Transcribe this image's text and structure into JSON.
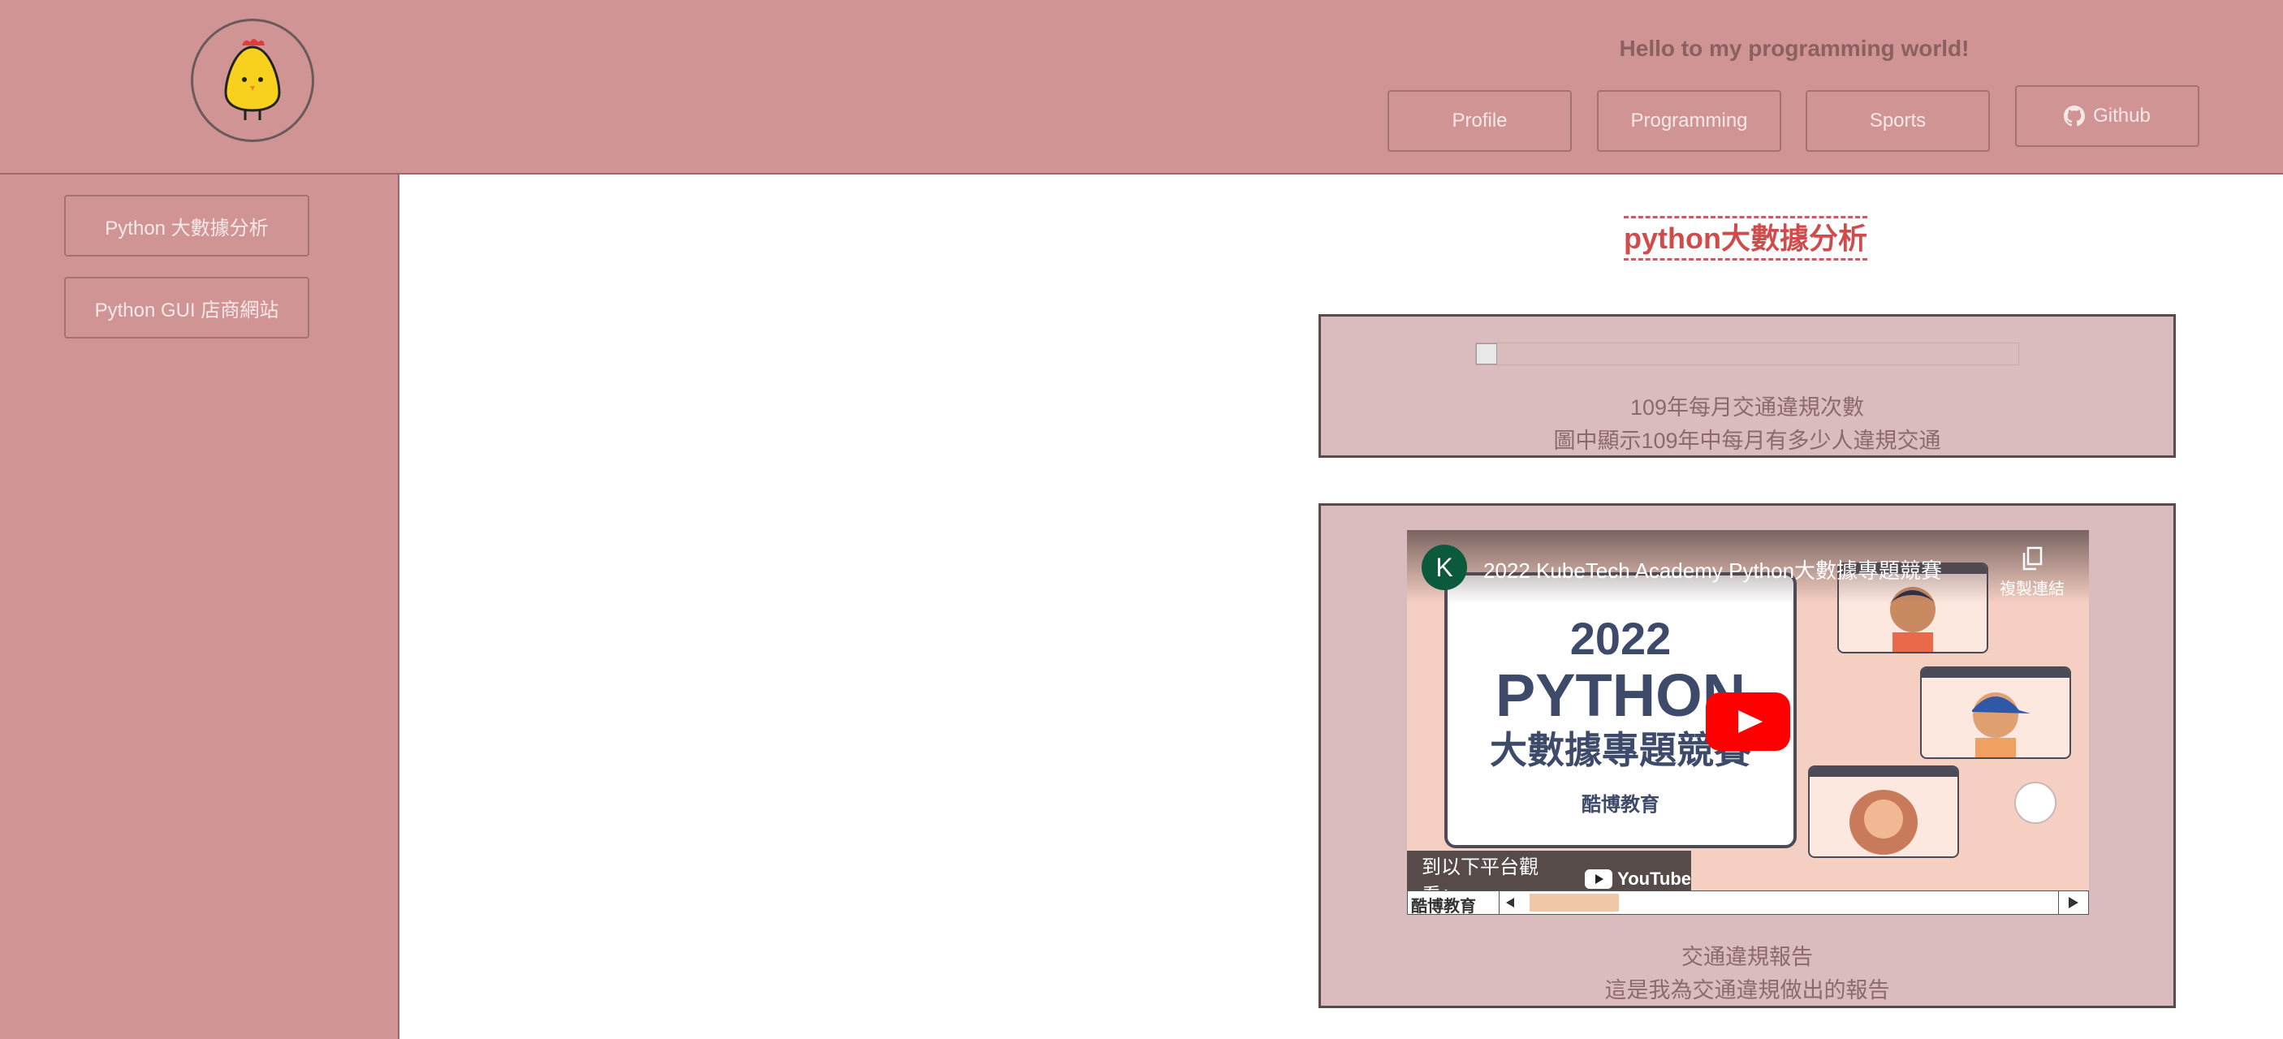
{
  "header": {
    "tagline": "Hello to my programming world!",
    "nav": [
      {
        "label": "Profile"
      },
      {
        "label": "Programming"
      },
      {
        "label": "Sports"
      },
      {
        "label": "Github",
        "icon": "github-icon"
      }
    ],
    "logo_icon": "chick-icon"
  },
  "sidebar": {
    "items": [
      {
        "label": "Python 大數據分析"
      },
      {
        "label": "Python GUI 店商網站"
      }
    ]
  },
  "main": {
    "title": "python大數據分析",
    "image_card": {
      "caption_title": "109年每月交通違規次數",
      "caption_desc": "圖中顯示109年中每月有多少人違規交通"
    },
    "video_card": {
      "video": {
        "channel_initial": "K",
        "title": "2022 KubeTech Academy Python大數據專題競賽",
        "copy_link": "複製連結",
        "slide_year": "2022",
        "slide_python": "PYTHON",
        "slide_subtitle": "大數據專題競賽",
        "slide_org": "酷博教育",
        "watch_on": "到以下平台觀看：",
        "youtube": "YouTube",
        "scroll_label": "酷博教育"
      },
      "caption_title": "交通違規報告",
      "caption_desc": "這是我為交通違規做出的報告"
    }
  },
  "colors": {
    "header_bg": "#d09494",
    "title_accent": "#d04c4c",
    "card_bg": "#dabcbe"
  }
}
